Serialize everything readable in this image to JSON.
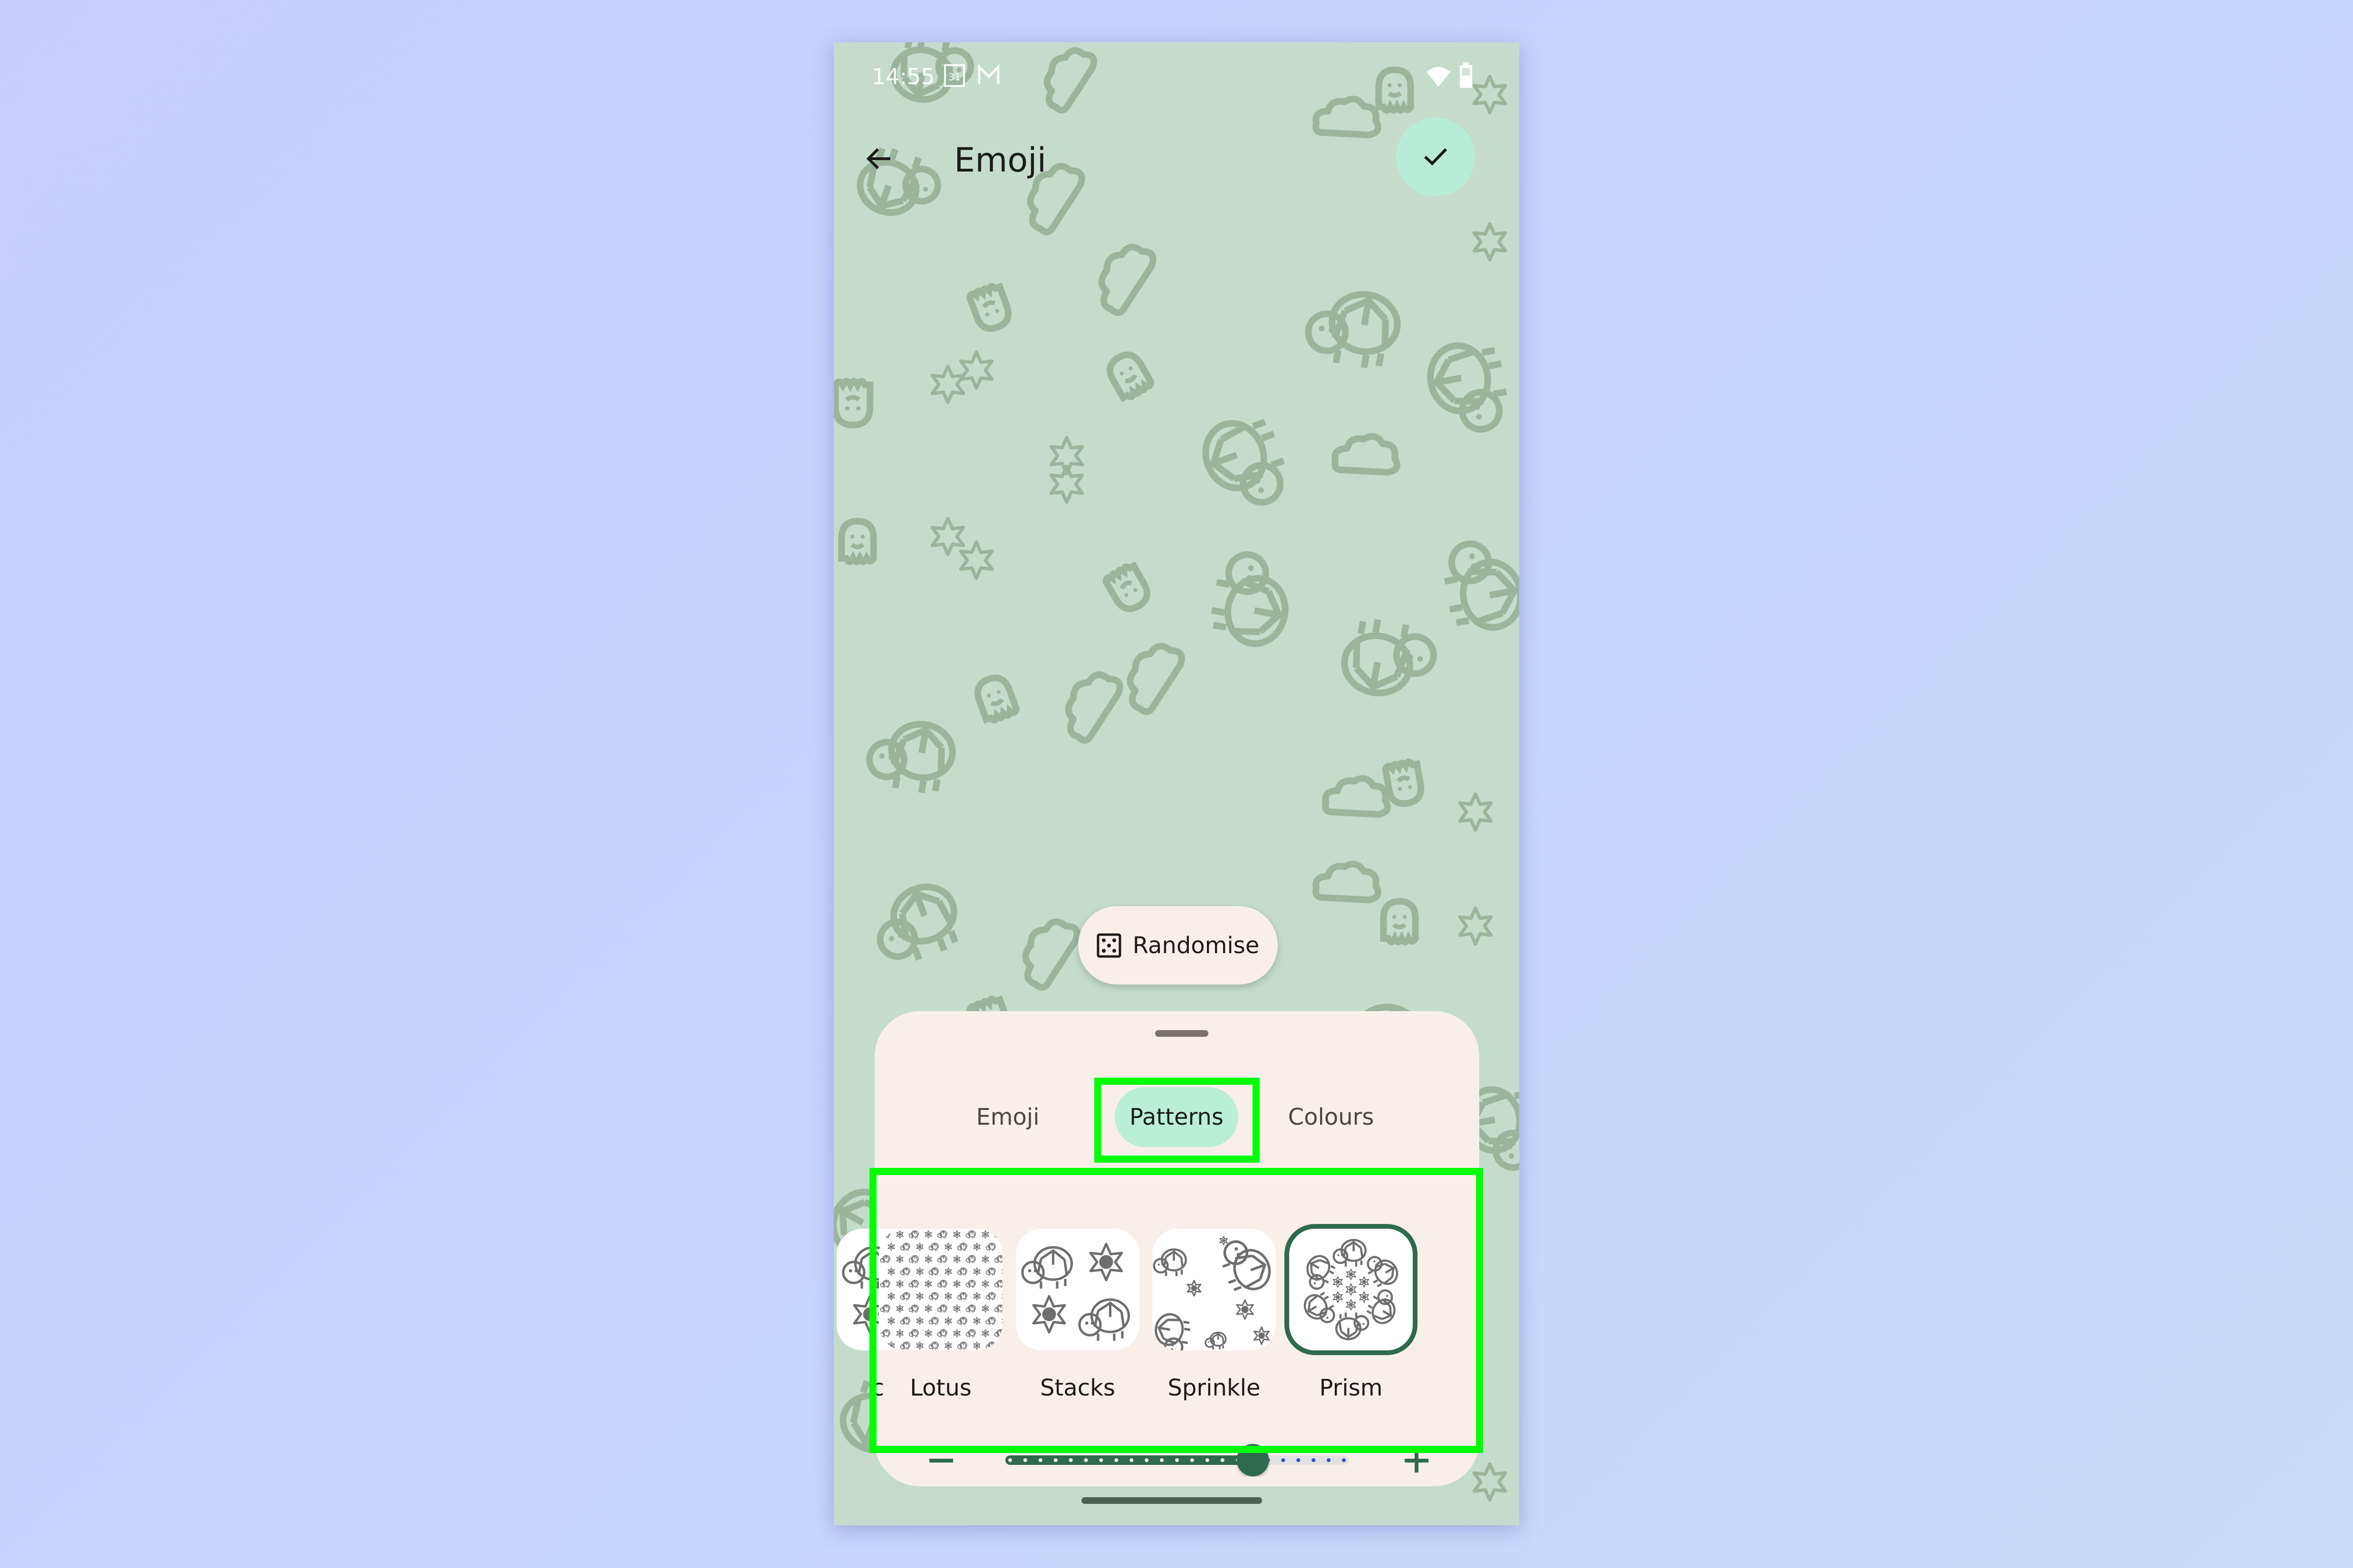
{
  "status_bar": {
    "time": "14:55",
    "left_icons": [
      "calendar-icon",
      "gmail-icon"
    ],
    "calendar_day": "31",
    "gmail_glyph": "M",
    "right_icons": [
      "wifi-icon",
      "battery-icon"
    ]
  },
  "app_bar": {
    "back_icon": "arrow-left-icon",
    "title": "Emoji",
    "done_icon": "check-icon"
  },
  "randomise": {
    "icon": "dice-icon",
    "label": "Randomise"
  },
  "bottom_sheet": {
    "tabs": [
      {
        "label": "Emoji",
        "active": false
      },
      {
        "label": "Patterns",
        "active": true
      },
      {
        "label": "Colours",
        "active": false
      }
    ],
    "patterns": [
      {
        "label": "c",
        "partial": true,
        "selected": false
      },
      {
        "label": "Lotus",
        "selected": false
      },
      {
        "label": "Stacks",
        "selected": false
      },
      {
        "label": "Sprinkle",
        "selected": false
      },
      {
        "label": "Prism",
        "selected": true
      }
    ],
    "size_slider": {
      "minus_icon": "minus-icon",
      "plus_icon": "plus-icon",
      "steps": 23,
      "value_index": 16
    }
  },
  "colors": {
    "wallpaper_bg": "#c5dccd",
    "doodle": "#9bb59d",
    "accent": "#2f6a4e",
    "chip": "#baeed7",
    "sheet": "#f8efea",
    "highlight": "#00ff00"
  }
}
